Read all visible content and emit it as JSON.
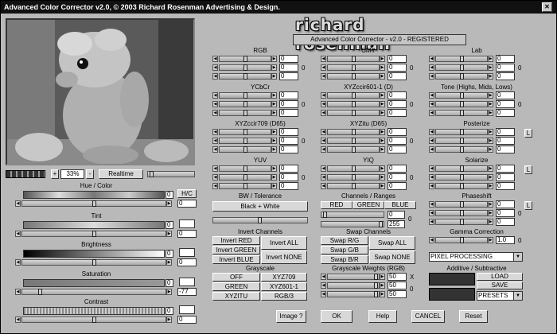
{
  "window": {
    "title": "Advanced Color Corrector v2.0, © 2003 Richard Rosenman Advertising & Design.",
    "logo": "richard rosenman",
    "registration": "Advanced Color Corrector - v2.0 - REGISTERED"
  },
  "preview": {
    "zoom": "33%",
    "realtime_label": "Realtime",
    "minus": "-",
    "plus": "+"
  },
  "left_controls": [
    {
      "label": "Hue / Color",
      "value": "0",
      "value2": "0",
      "extra": "H/C"
    },
    {
      "label": "Tint",
      "value": "0",
      "value2": "0"
    },
    {
      "label": "Brightness",
      "value": "0",
      "value2": "0"
    },
    {
      "label": "Saturation",
      "value": "0",
      "value2": "-77"
    },
    {
      "label": "Contrast",
      "value": "0",
      "value2": "0"
    }
  ],
  "col1": [
    {
      "title": "RGB",
      "values": [
        "0",
        "0",
        "0"
      ],
      "sum": "0"
    },
    {
      "title": "YCbCr",
      "values": [
        "0",
        "0",
        "0"
      ],
      "sum": "0"
    },
    {
      "title": "XYZccir709 (D65)",
      "values": [
        "0",
        "0",
        "0"
      ],
      "sum": "0"
    },
    {
      "title": "YUV",
      "values": [
        "0",
        "0",
        "0"
      ],
      "sum": "0"
    }
  ],
  "col2": [
    {
      "title": "CMY",
      "values": [
        "0",
        "0",
        "0"
      ],
      "sum": "0"
    },
    {
      "title": "XYZccir601-1 (D)",
      "values": [
        "0",
        "0",
        "0"
      ],
      "sum": "0"
    },
    {
      "title": "XYZitu (D65)",
      "values": [
        "0",
        "0",
        "0"
      ],
      "sum": "0"
    },
    {
      "title": "YIQ",
      "values": [
        "0",
        "0",
        "0"
      ],
      "sum": "0"
    }
  ],
  "col3": [
    {
      "title": "Lab",
      "values": [
        "0",
        "0",
        "0"
      ],
      "sum": "0"
    },
    {
      "title": "Tone (Highs, Mids, Lows)",
      "values": [
        "0",
        "0",
        "0"
      ],
      "sum": "0"
    },
    {
      "title": "Posterize",
      "values": [
        "0",
        "0",
        "0"
      ],
      "extra": "L"
    },
    {
      "title": "Solarize",
      "values": [
        "0",
        "0",
        "0"
      ],
      "extra": "L"
    },
    {
      "title": "Phaseshift",
      "values": [
        "0",
        "0",
        "0"
      ],
      "sum": "0",
      "extra": "L"
    }
  ],
  "bw": {
    "title": "BW / Tolerance",
    "button": "Black + White"
  },
  "channels": {
    "title": "Channels / Ranges",
    "red": "RED",
    "green": "GREEN",
    "blue": "BLUE",
    "low": "0",
    "high": "255",
    "sum": "0"
  },
  "gamma": {
    "title": "Gamma Correction",
    "value": "1.0",
    "sum": "0"
  },
  "invert": {
    "title": "Invert Channels",
    "red": "Invert RED",
    "green": "Invert GREEN",
    "blue": "Invert BLUE",
    "all": "Invert ALL",
    "none": "Invert NONE"
  },
  "swap": {
    "title": "Swap Channels",
    "rg": "Swap R/G",
    "gb": "Swap G/B",
    "br": "Swap B/R",
    "all": "Swap ALL",
    "none": "Swap NONE"
  },
  "processing": {
    "selected": "PIXEL PROCESSING"
  },
  "grayscale": {
    "title": "Grayscale",
    "off": "OFF",
    "green": "GREEN",
    "xyzitu": "XYZITU",
    "xyz709": "XYZ709",
    "xyz601": "XYZ601-1",
    "rgb3": "RGB/3"
  },
  "weights": {
    "title": "Grayscale Weights (RGB)",
    "values": [
      "50",
      "50",
      "50"
    ],
    "sum": "0",
    "x": "X"
  },
  "additive": {
    "title": "Additive / Subtractive",
    "load": "LOAD",
    "save": "SAVE",
    "presets": "PRESETS"
  },
  "bottom": {
    "image": "Image ?",
    "ok": "OK",
    "help": "Help",
    "cancel": "CANCEL",
    "reset": "Reset"
  },
  "colors": {
    "window_bg": "#b9b9b9",
    "titlebar": "#111111"
  }
}
